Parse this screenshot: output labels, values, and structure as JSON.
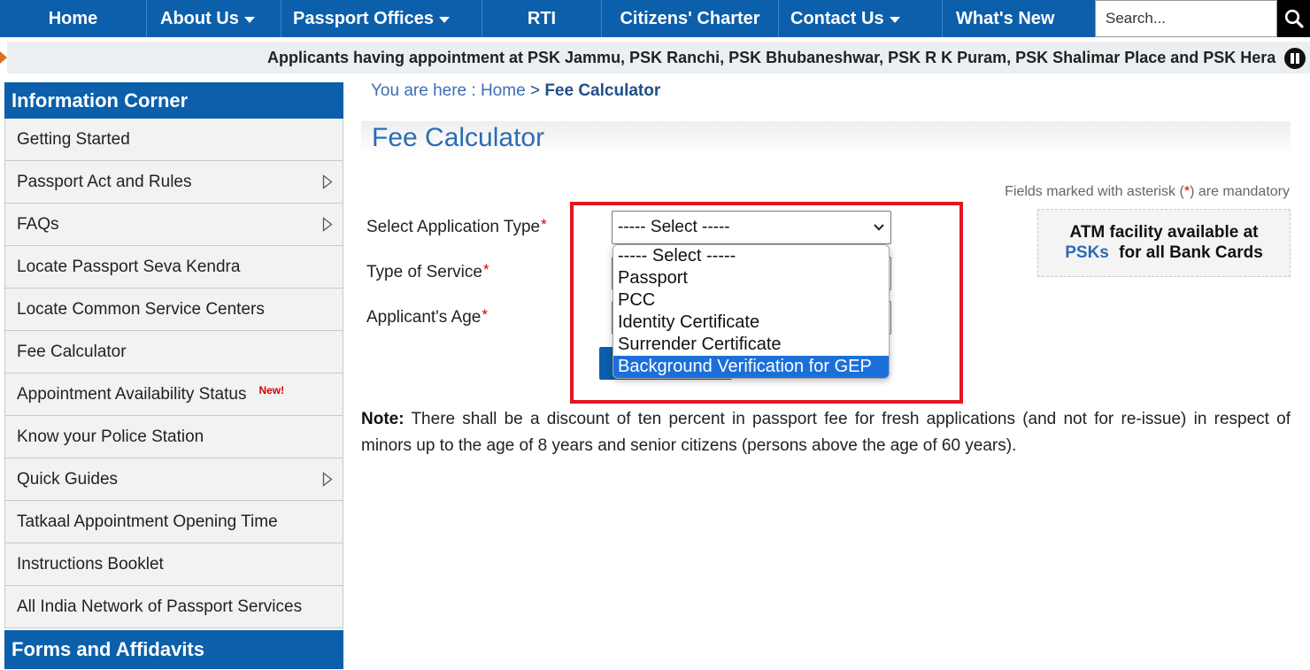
{
  "nav": {
    "items": [
      {
        "label": "Home",
        "dropdown": false
      },
      {
        "label": "About Us",
        "dropdown": true
      },
      {
        "label": "Passport Offices",
        "dropdown": true
      },
      {
        "label": "RTI",
        "dropdown": false
      },
      {
        "label": "Citizens' Charter",
        "dropdown": false
      },
      {
        "label": "Contact Us",
        "dropdown": true
      },
      {
        "label": "What's New",
        "dropdown": false
      }
    ],
    "search": {
      "placeholder": "Search...",
      "icon": "search-icon"
    }
  },
  "ticker": {
    "text": "Applicants having appointment at PSK Jammu, PSK Ranchi, PSK Bhubaneshwar, PSK R K Puram, PSK Shalimar Place and PSK Hera",
    "icon": "pause-icon"
  },
  "sidebar": {
    "heading": "Information Corner",
    "items": [
      {
        "label": "Getting Started"
      },
      {
        "label": "Passport Act and Rules",
        "submenu": true
      },
      {
        "label": "FAQs",
        "submenu": true
      },
      {
        "label": "Locate Passport Seva Kendra"
      },
      {
        "label": "Locate Common Service Centers"
      },
      {
        "label": "Fee Calculator"
      },
      {
        "label": "Appointment Availability Status",
        "badge": "New!"
      },
      {
        "label": "Know your Police Station"
      },
      {
        "label": "Quick Guides",
        "submenu": true
      },
      {
        "label": "Tatkaal Appointment Opening Time"
      },
      {
        "label": "Instructions Booklet"
      },
      {
        "label": "All India Network of Passport Services"
      }
    ],
    "footer_heading": "Forms and Affidavits"
  },
  "breadcrumb": {
    "prefix": "You are here :",
    "home": "Home",
    "separator": ">",
    "current": "Fee Calculator"
  },
  "page": {
    "title": "Fee Calculator",
    "mandatory_note": {
      "before": "Fields marked with asterisk (",
      "asterisk": "*",
      "after": ") are mandatory"
    }
  },
  "form": {
    "fields": [
      {
        "label": "Select Application Type",
        "required": "*",
        "value": "----- Select -----"
      },
      {
        "label": "Type of Service",
        "required": "*"
      },
      {
        "label": "Applicant's Age",
        "required": "*"
      }
    ],
    "dropdown": {
      "open": true,
      "options": [
        {
          "label": "----- Select -----"
        },
        {
          "label": "Passport"
        },
        {
          "label": "PCC"
        },
        {
          "label": "Identity Certificate"
        },
        {
          "label": "Surrender Certificate"
        },
        {
          "label": "Background Verification for GEP",
          "highlighted": true
        }
      ]
    }
  },
  "atm": {
    "line1": "ATM facility available at",
    "link": "PSKs",
    "line2": "for all Bank Cards"
  },
  "note": {
    "label": "Note:",
    "text": "There shall be a discount of ten percent in passport fee for fresh applications (and not for re-issue) in respect of minors up to the age of 8 years and senior citizens (persons above the age of 60 years)."
  },
  "colors": {
    "nav_bg": "#0b5fab",
    "link": "#2b6cb5",
    "highlight": "#1b6fd9",
    "annotation": "#e3161e",
    "required": "#d40000"
  }
}
